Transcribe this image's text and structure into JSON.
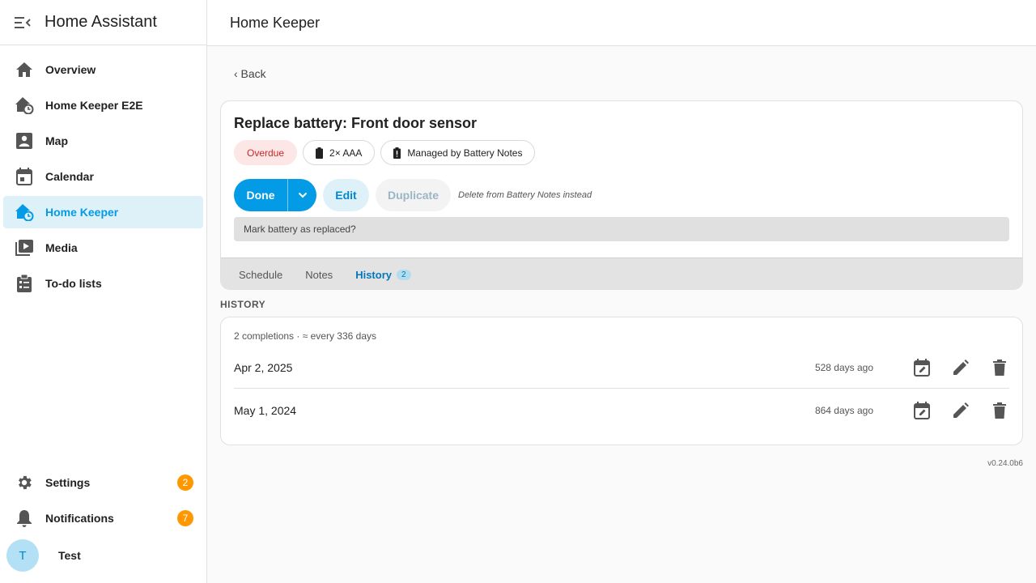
{
  "sidebar": {
    "app_title": "Home Assistant",
    "items": [
      {
        "label": "Overview",
        "icon": "home-icon"
      },
      {
        "label": "Home Keeper E2E",
        "icon": "home-clock-icon"
      },
      {
        "label": "Map",
        "icon": "account-box-icon"
      },
      {
        "label": "Calendar",
        "icon": "calendar-icon"
      },
      {
        "label": "Home Keeper",
        "icon": "home-clock-icon"
      },
      {
        "label": "Media",
        "icon": "media-icon"
      },
      {
        "label": "To-do lists",
        "icon": "clipboard-list-icon"
      }
    ],
    "settings": {
      "label": "Settings",
      "badge": "2"
    },
    "notifications": {
      "label": "Notifications",
      "badge": "7"
    },
    "user": {
      "initial": "T",
      "name": "Test"
    }
  },
  "topbar": {
    "title": "Home Keeper"
  },
  "main": {
    "back_label": "‹ Back",
    "task": {
      "title": "Replace battery: Front door sensor",
      "chips": {
        "status": "Overdue",
        "battery": "2× AAA",
        "managed": "Managed by Battery Notes"
      },
      "actions": {
        "done": "Done",
        "edit": "Edit",
        "duplicate": "Duplicate",
        "delete_note": "Delete from Battery Notes instead"
      },
      "prompt": "Mark battery as replaced?"
    },
    "tabs": [
      {
        "label": "Schedule"
      },
      {
        "label": "Notes"
      },
      {
        "label": "History",
        "count": "2"
      }
    ],
    "history": {
      "section_label": "HISTORY",
      "summary": "2 completions · ≈ every 336 days",
      "rows": [
        {
          "date": "Apr 2, 2025",
          "ago": "528 days ago"
        },
        {
          "date": "May 1, 2024",
          "ago": "864 days ago"
        }
      ]
    },
    "version": "v0.24.0b6"
  },
  "colors": {
    "accent": "#039be5",
    "overdue_bg": "#fde6e6",
    "overdue_text": "#c62828",
    "badge": "#ff9800"
  }
}
